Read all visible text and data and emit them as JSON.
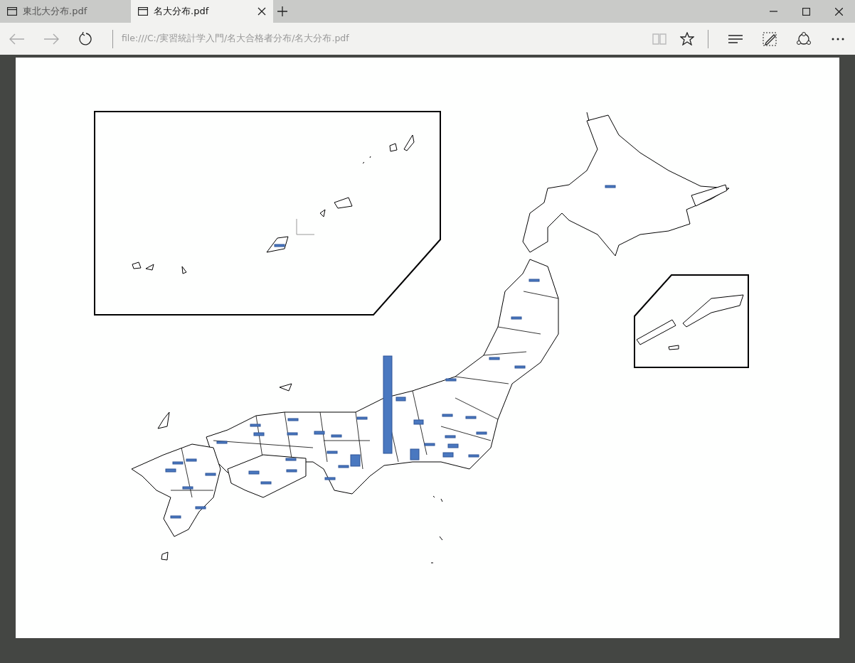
{
  "tabs": [
    {
      "label": "東北大分布.pdf",
      "selected": false
    },
    {
      "label": "名大分布.pdf",
      "selected": true
    }
  ],
  "address": {
    "value": "file:///C:/実習統計学入門/名大合格者分布/名大分布.pdf"
  }
}
